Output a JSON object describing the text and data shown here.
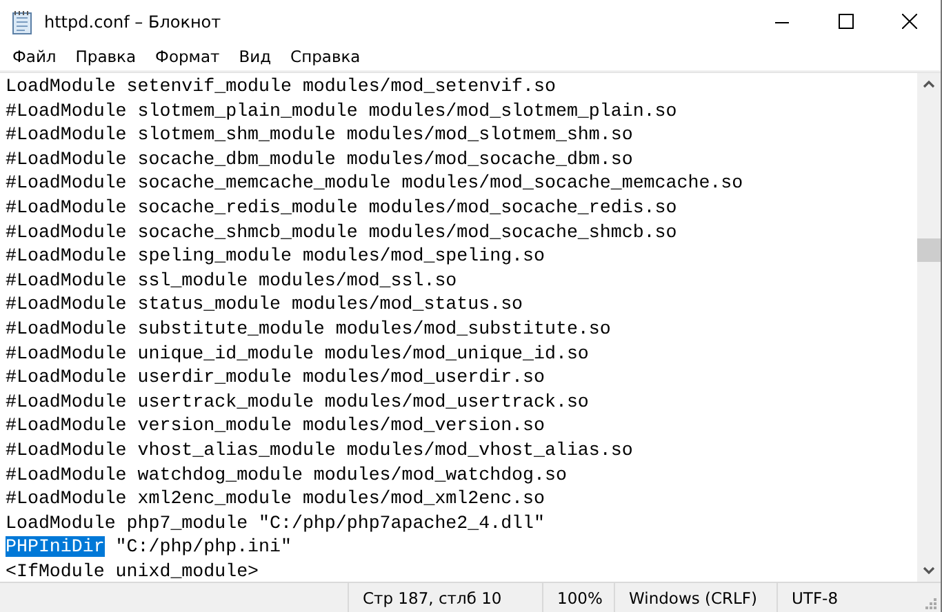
{
  "window": {
    "title": "httpd.conf – Блокнот"
  },
  "menu": [
    "Файл",
    "Правка",
    "Формат",
    "Вид",
    "Справка"
  ],
  "editor": {
    "lines": [
      {
        "text": "LoadModule setenvif_module modules/mod_setenvif.so"
      },
      {
        "text": "#LoadModule slotmem_plain_module modules/mod_slotmem_plain.so"
      },
      {
        "text": "#LoadModule slotmem_shm_module modules/mod_slotmem_shm.so"
      },
      {
        "text": "#LoadModule socache_dbm_module modules/mod_socache_dbm.so"
      },
      {
        "text": "#LoadModule socache_memcache_module modules/mod_socache_memcache.so"
      },
      {
        "text": "#LoadModule socache_redis_module modules/mod_socache_redis.so"
      },
      {
        "text": "#LoadModule socache_shmcb_module modules/mod_socache_shmcb.so"
      },
      {
        "text": "#LoadModule speling_module modules/mod_speling.so"
      },
      {
        "text": "#LoadModule ssl_module modules/mod_ssl.so"
      },
      {
        "text": "#LoadModule status_module modules/mod_status.so"
      },
      {
        "text": "#LoadModule substitute_module modules/mod_substitute.so"
      },
      {
        "text": "#LoadModule unique_id_module modules/mod_unique_id.so"
      },
      {
        "text": "#LoadModule userdir_module modules/mod_userdir.so"
      },
      {
        "text": "#LoadModule usertrack_module modules/mod_usertrack.so"
      },
      {
        "text": "#LoadModule version_module modules/mod_version.so"
      },
      {
        "text": "#LoadModule vhost_alias_module modules/mod_vhost_alias.so"
      },
      {
        "text": "#LoadModule watchdog_module modules/mod_watchdog.so"
      },
      {
        "text": "#LoadModule xml2enc_module modules/mod_xml2enc.so"
      },
      {
        "text": "LoadModule php7_module \"C:/php/php7apache2_4.dll\""
      },
      {
        "highlight": "PHPIniDir",
        "text": " \"C:/php/php.ini\""
      },
      {
        "text": "<IfModule unixd_module>"
      }
    ]
  },
  "status_bar": {
    "position": "Стр 187, стлб 10",
    "zoom": "100%",
    "line_endings": "Windows (CRLF)",
    "encoding": "UTF-8"
  }
}
